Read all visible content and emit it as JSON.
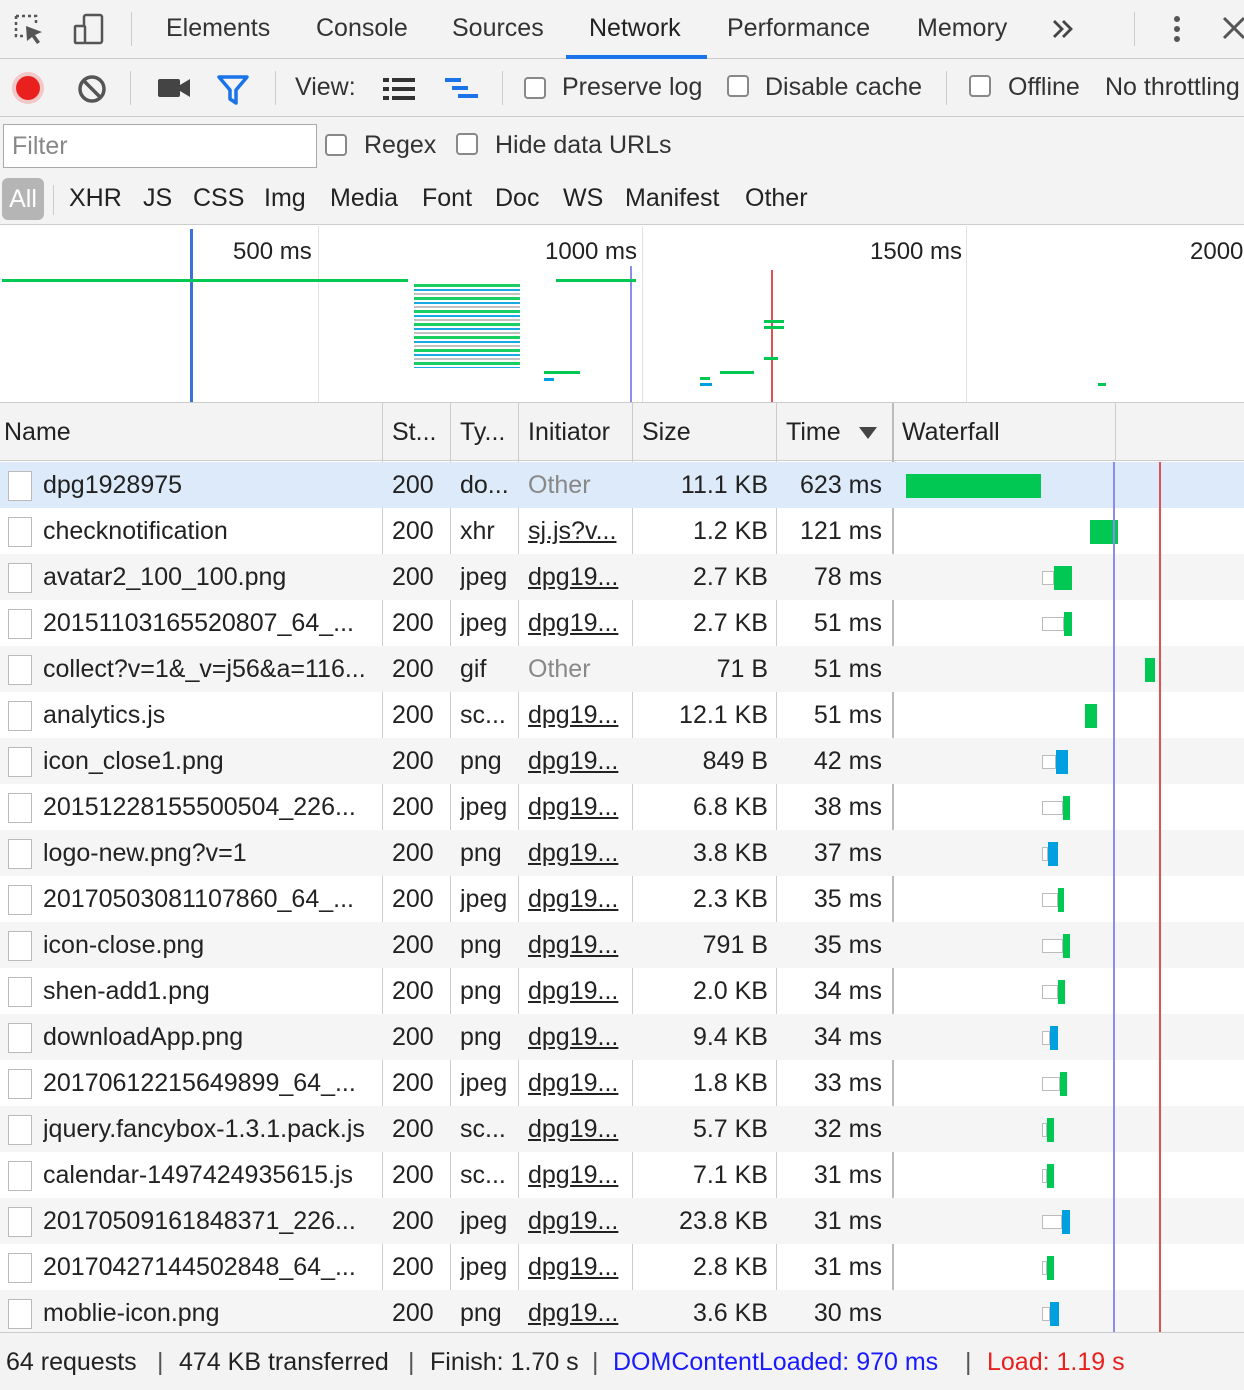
{
  "tabs": {
    "items": [
      "Elements",
      "Console",
      "Sources",
      "Network",
      "Performance",
      "Memory"
    ],
    "active": "Network",
    "overflow_icon": "chevron-double-right-icon",
    "menu_icon": "kebab-menu-icon",
    "close_icon": "close-icon"
  },
  "toolbar": {
    "view_label": "View:",
    "preserve_log": "Preserve log",
    "disable_cache": "Disable cache",
    "offline": "Offline",
    "throttling": "No throttling",
    "record_color": "#e8211f",
    "filter_color": "#1a73e8"
  },
  "filter": {
    "placeholder": "Filter",
    "regex": "Regex",
    "hide_data_urls": "Hide data URLs"
  },
  "types": [
    "All",
    "XHR",
    "JS",
    "CSS",
    "Img",
    "Media",
    "Font",
    "Doc",
    "WS",
    "Manifest",
    "Other"
  ],
  "overview": {
    "ticks": [
      "500 ms",
      "1000 ms",
      "1500 ms",
      "2000"
    ]
  },
  "columns": {
    "name": "Name",
    "status": "St...",
    "type": "Ty...",
    "initiator": "Initiator",
    "size": "Size",
    "time": "Time",
    "waterfall": "Waterfall",
    "sort_icon": "sort-descending-icon"
  },
  "requests": [
    {
      "name": "dpg1928975",
      "status": "200",
      "type": "do...",
      "initiator": "Other",
      "size": "11.1 KB",
      "time": "623 ms"
    },
    {
      "name": "checknotification",
      "status": "200",
      "type": "xhr",
      "initiator": "sj.js?v...",
      "size": "1.2 KB",
      "time": "121 ms"
    },
    {
      "name": "avatar2_100_100.png",
      "status": "200",
      "type": "jpeg",
      "initiator": "dpg19...",
      "size": "2.7 KB",
      "time": "78 ms"
    },
    {
      "name": "20151103165520807_64_...",
      "status": "200",
      "type": "jpeg",
      "initiator": "dpg19...",
      "size": "2.7 KB",
      "time": "51 ms"
    },
    {
      "name": "collect?v=1&_v=j56&a=116...",
      "status": "200",
      "type": "gif",
      "initiator": "Other",
      "size": "71 B",
      "time": "51 ms"
    },
    {
      "name": "analytics.js",
      "status": "200",
      "type": "sc...",
      "initiator": "dpg19...",
      "size": "12.1 KB",
      "time": "51 ms"
    },
    {
      "name": "icon_close1.png",
      "status": "200",
      "type": "png",
      "initiator": "dpg19...",
      "size": "849 B",
      "time": "42 ms"
    },
    {
      "name": "20151228155500504_226...",
      "status": "200",
      "type": "jpeg",
      "initiator": "dpg19...",
      "size": "6.8 KB",
      "time": "38 ms"
    },
    {
      "name": "logo-new.png?v=1",
      "status": "200",
      "type": "png",
      "initiator": "dpg19...",
      "size": "3.8 KB",
      "time": "37 ms"
    },
    {
      "name": "20170503081107860_64_...",
      "status": "200",
      "type": "jpeg",
      "initiator": "dpg19...",
      "size": "2.3 KB",
      "time": "35 ms"
    },
    {
      "name": "icon-close.png",
      "status": "200",
      "type": "png",
      "initiator": "dpg19...",
      "size": "791 B",
      "time": "35 ms"
    },
    {
      "name": "shen-add1.png",
      "status": "200",
      "type": "png",
      "initiator": "dpg19...",
      "size": "2.0 KB",
      "time": "34 ms"
    },
    {
      "name": "downloadApp.png",
      "status": "200",
      "type": "png",
      "initiator": "dpg19...",
      "size": "9.4 KB",
      "time": "34 ms"
    },
    {
      "name": "20170612215649899_64_...",
      "status": "200",
      "type": "jpeg",
      "initiator": "dpg19...",
      "size": "1.8 KB",
      "time": "33 ms"
    },
    {
      "name": "jquery.fancybox-1.3.1.pack.js",
      "status": "200",
      "type": "sc...",
      "initiator": "dpg19...",
      "size": "5.7 KB",
      "time": "32 ms"
    },
    {
      "name": "calendar-1497424935615.js",
      "status": "200",
      "type": "sc...",
      "initiator": "dpg19...",
      "size": "7.1 KB",
      "time": "31 ms"
    },
    {
      "name": "20170509161848371_226...",
      "status": "200",
      "type": "jpeg",
      "initiator": "dpg19...",
      "size": "23.8 KB",
      "time": "31 ms"
    },
    {
      "name": "20170427144502848_64_...",
      "status": "200",
      "type": "jpeg",
      "initiator": "dpg19...",
      "size": "2.8 KB",
      "time": "31 ms"
    },
    {
      "name": "moblie-icon.png",
      "status": "200",
      "type": "png",
      "initiator": "dpg19...",
      "size": "3.6 KB",
      "time": "30 ms"
    }
  ],
  "footer": {
    "requests": "64 requests",
    "transferred": "474 KB transferred",
    "finish": "Finish: 1.70 s",
    "dcl": "DOMContentLoaded: 970 ms",
    "load": "Load: 1.19 s",
    "dcl_color": "#1a1aff",
    "load_color": "#e8211f"
  },
  "colors": {
    "waterfall_green": "#00c853",
    "waterfall_blue": "#00a0e0",
    "dcl_line": "#8c8cf0",
    "load_line": "#e05050"
  }
}
